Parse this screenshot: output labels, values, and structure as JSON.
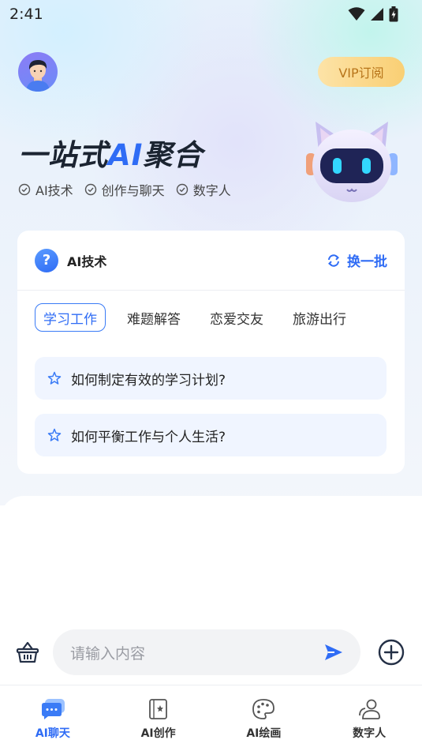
{
  "status_bar": {
    "time": "2:41"
  },
  "header": {
    "vip_label": "VIP订阅"
  },
  "hero": {
    "title_prefix": "一站式",
    "title_ai": "AI",
    "title_suffix": "聚合",
    "features": [
      "AI技术",
      "创作与聊天",
      "数字人"
    ]
  },
  "card": {
    "title": "AI技术",
    "refresh_label": "换一批",
    "tabs": [
      "学习工作",
      "难题解答",
      "恋爱交友",
      "旅游出行"
    ],
    "active_tab": 0,
    "questions": [
      "如何制定有效的学习计划?",
      "如何平衡工作与个人生活?"
    ]
  },
  "chat_input": {
    "placeholder": "请输入内容"
  },
  "tab_bar": {
    "items": [
      {
        "label": "AI聊天",
        "icon": "chat-bubble-icon",
        "active": true
      },
      {
        "label": "AI创作",
        "icon": "create-book-icon",
        "active": false
      },
      {
        "label": "AI绘画",
        "icon": "palette-icon",
        "active": false
      },
      {
        "label": "数字人",
        "icon": "digital-human-icon",
        "active": false
      }
    ]
  },
  "colors": {
    "accent": "#2f6cf5",
    "vip_text": "#b8751a",
    "question_bg": "#f0f5ff"
  }
}
